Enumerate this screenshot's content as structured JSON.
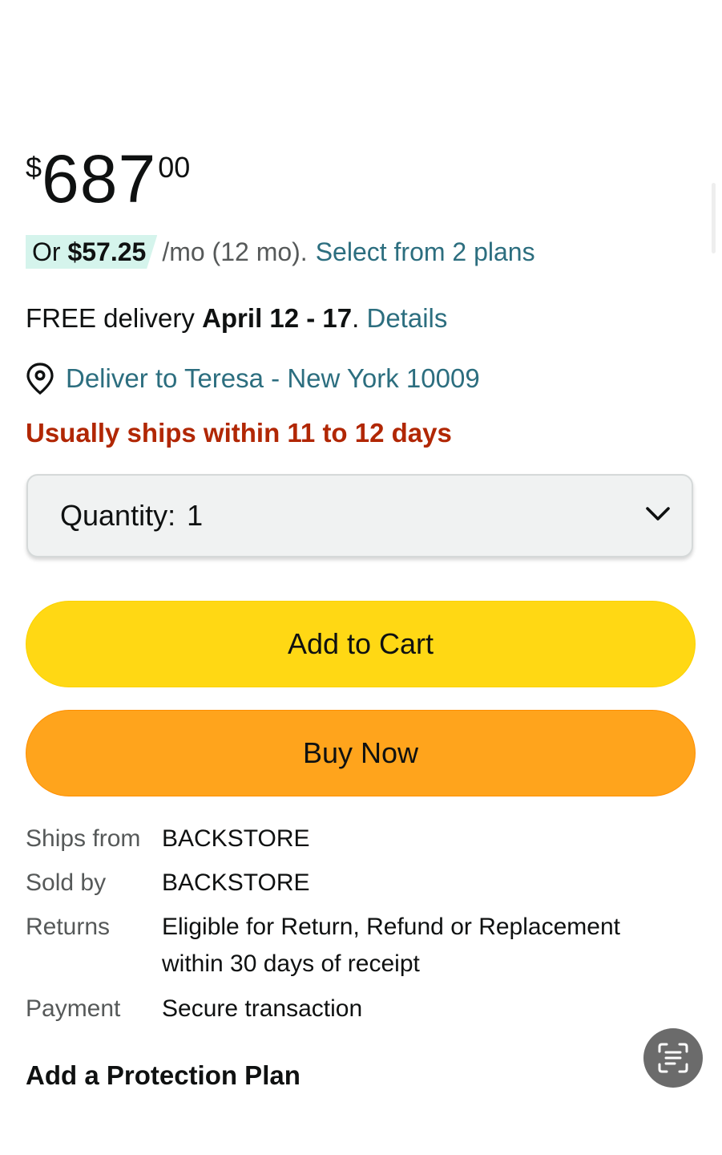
{
  "price": {
    "symbol": "$",
    "whole": "687",
    "fraction": "00"
  },
  "installment": {
    "prefix": "Or",
    "amount": "$57.25",
    "term": "/mo (12 mo).",
    "link": "Select from 2 plans"
  },
  "delivery": {
    "prefix": "FREE delivery",
    "dates": "April 12 - 17",
    "separator": ".",
    "details_link": "Details"
  },
  "deliver_to": {
    "icon": "location-pin-icon",
    "text": "Deliver to Teresa - New York 10009"
  },
  "ships_within": "Usually ships within 11 to 12 days",
  "quantity": {
    "label": "Quantity:",
    "value": "1",
    "icon": "chevron-down-icon"
  },
  "buttons": {
    "add_to_cart": "Add to Cart",
    "buy_now": "Buy Now"
  },
  "info": {
    "ships_from": {
      "label": "Ships from",
      "value": "BACKSTORE"
    },
    "sold_by": {
      "label": "Sold by",
      "value": "BACKSTORE"
    },
    "returns": {
      "label": "Returns",
      "line1": "Eligible for Return, Refund or Replacement",
      "line2": "within 30 days of receipt"
    },
    "payment": {
      "label": "Payment",
      "value": "Secure transaction"
    }
  },
  "protection_title": "Add a Protection Plan",
  "fab_icon": "scan-text-icon",
  "colors": {
    "link": "#2c6e7f",
    "add_to_cart": "#ffd814",
    "buy_now": "#ffa41c",
    "ships_warning": "#b12704",
    "installment_highlight": "#d5f4ec"
  }
}
